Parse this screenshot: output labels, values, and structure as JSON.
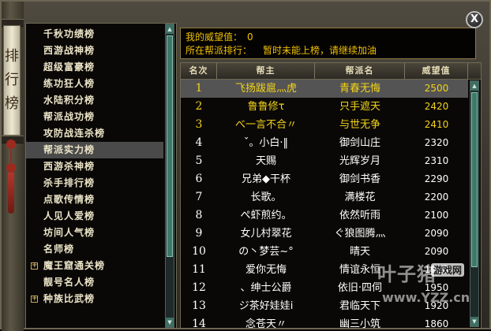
{
  "scroll_title": [
    "排",
    "行",
    "榜"
  ],
  "close_label": "X",
  "categories": [
    {
      "label": "千秋功绩榜",
      "expandable": false
    },
    {
      "label": "西游战神榜",
      "expandable": false
    },
    {
      "label": "超级富豪榜",
      "expandable": false
    },
    {
      "label": "练功狂人榜",
      "expandable": false
    },
    {
      "label": "水陆积分榜",
      "expandable": false
    },
    {
      "label": "帮派战功榜",
      "expandable": false
    },
    {
      "label": "攻防战连杀榜",
      "expandable": false
    },
    {
      "label": "帮派实力榜",
      "expandable": false,
      "selected": true
    },
    {
      "label": "西游杀神榜",
      "expandable": false
    },
    {
      "label": "杀手排行榜",
      "expandable": false
    },
    {
      "label": "点歌传情榜",
      "expandable": false
    },
    {
      "label": "人见人爱榜",
      "expandable": false
    },
    {
      "label": "坊间人气榜",
      "expandable": false
    },
    {
      "label": "名师榜",
      "expandable": false
    },
    {
      "label": "魔王窟通关榜",
      "expandable": true
    },
    {
      "label": "靓号名人榜",
      "expandable": false
    },
    {
      "label": "种族比武榜",
      "expandable": true
    }
  ],
  "info": {
    "prestige_label": "我的威望值：",
    "prestige_value": "0",
    "rank_label": "所在帮派排行：",
    "rank_status": "暂时未能上榜，请继续加油"
  },
  "table": {
    "headers": [
      "名次",
      "帮主",
      "帮派名",
      "威望值"
    ],
    "rows": [
      {
        "rank": "1",
        "leader": "飞扬跋扈灬虎",
        "guild": "青春无悔",
        "score": "2500"
      },
      {
        "rank": "2",
        "leader": "鲁鲁修τ",
        "guild": "只手遮天",
        "score": "2420"
      },
      {
        "rank": "3",
        "leader": "べ一言不合〃",
        "guild": "与世无争",
        "score": "2410"
      },
      {
        "rank": "4",
        "leader": "ˇ。小白·‖",
        "guild": "御剑山庄",
        "score": "2320"
      },
      {
        "rank": "5",
        "leader": "天赐",
        "guild": "光辉岁月",
        "score": "2310"
      },
      {
        "rank": "6",
        "leader": "兄弟◆干杯",
        "guild": "御剑书香",
        "score": "2290"
      },
      {
        "rank": "7",
        "leader": "长歌。",
        "guild": "满楼花",
        "score": "2200"
      },
      {
        "rank": "8",
        "leader": "ぺ虾煎约。",
        "guild": "依然听雨",
        "score": "2100"
      },
      {
        "rank": "9",
        "leader": "女儿村翠花",
        "guild": "ぐ狼图腾灬",
        "score": "2090"
      },
      {
        "rank": "10",
        "leader": "の丶梦芸~°",
        "guild": "晴天",
        "score": "2090"
      },
      {
        "rank": "11",
        "leader": "爱你无悔",
        "guild": "情谊永恒",
        "score": "1960"
      },
      {
        "rank": "12",
        "leader": "、绅士公爵",
        "guild": "依旧·四伺",
        "score": "1950"
      },
      {
        "rank": "13",
        "leader": "ジ茶好娃娃i",
        "guild": "君临天下",
        "score": "1920"
      },
      {
        "rank": "14",
        "leader": "念苍天〃",
        "guild": "幽三小筑",
        "score": "1860"
      }
    ],
    "colors": {
      "header_text": "#e6dcb7",
      "top_rank": "#f2d21a",
      "normal": "#ffffff",
      "info_text": "#f0c200"
    }
  },
  "scroll": {
    "left_position": 0.0,
    "right_position": 0.0
  },
  "watermark": {
    "brand": "叶子猪",
    "tag": "游戏网",
    "url": "www.YZZ.cn"
  }
}
